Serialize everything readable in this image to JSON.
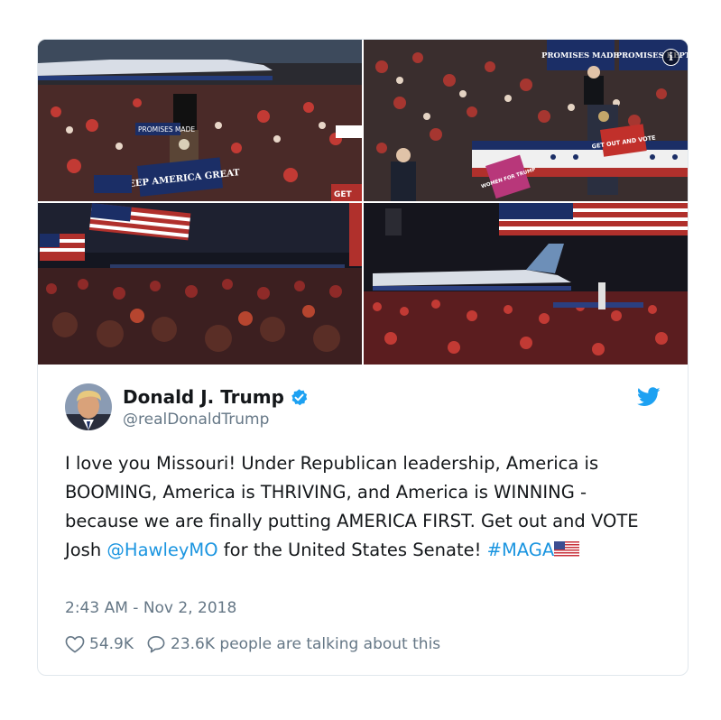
{
  "tweet": {
    "author": {
      "display_name": "Donald J. Trump",
      "handle": "@realDonaldTrump",
      "verified": true
    },
    "text": {
      "part1": "I love you Missouri! Under Republican leadership, America is BOOMING, America is THRIVING, and America is WINNING - because we are finally putting AMERICA FIRST. Get out and VOTE Josh ",
      "mention": "@HawleyMO",
      "part2": " for the United States Senate! ",
      "hashtag": "#MAGA",
      "emoji": "us-flag"
    },
    "timestamp": "2:43 AM - Nov 2, 2018",
    "likes": "54.9K",
    "talking": "23.6K people are talking about this"
  },
  "photos": {
    "photo1": {
      "banner": "KEEP AMERICA GREAT",
      "sign1": "PROMISES MADE",
      "sign2": "GET"
    },
    "photo2": {
      "banner1": "PROMISES MADE",
      "banner2": "PROMISES KEPT",
      "sign1": "GET OUT AND VOTE",
      "sign2": "WOMEN FOR TRUMP"
    }
  },
  "icons": [
    "info-icon",
    "verified-badge-icon",
    "twitter-bird-icon",
    "heart-icon",
    "reply-bubble-icon"
  ],
  "colors": {
    "link": "#1b95e0",
    "muted": "#657786",
    "border": "#e1e8ed",
    "verified": "#1da1f2"
  }
}
